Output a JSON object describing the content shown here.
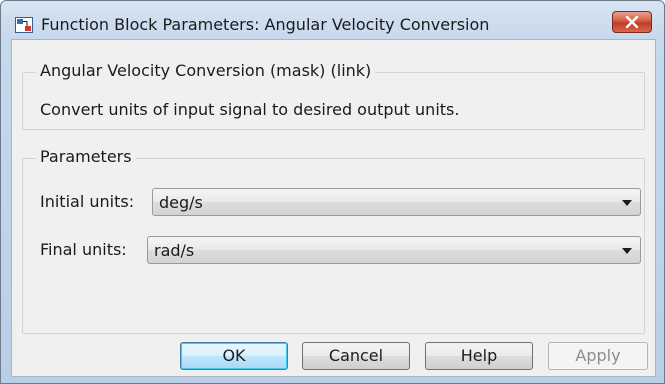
{
  "window": {
    "title": "Function Block Parameters: Angular Velocity Conversion"
  },
  "mask_group": {
    "title": "Angular Velocity Conversion (mask) (link)",
    "description": "Convert units of input signal to desired output units."
  },
  "params_group": {
    "title": "Parameters",
    "initial_units": {
      "label": "Initial units:",
      "value": "deg/s"
    },
    "final_units": {
      "label": "Final units:",
      "value": "rad/s"
    }
  },
  "buttons": {
    "ok": "OK",
    "cancel": "Cancel",
    "help": "Help",
    "apply": "Apply"
  },
  "colors": {
    "title_bar": "#c6d8ec",
    "close_button": "#c94a33",
    "dialog_background": "#f0f0f0",
    "default_button_border": "#3c7fb1"
  },
  "icons": {
    "app": "simulink-block-icon",
    "close": "close-icon",
    "dropdown": "chevron-down-icon"
  }
}
